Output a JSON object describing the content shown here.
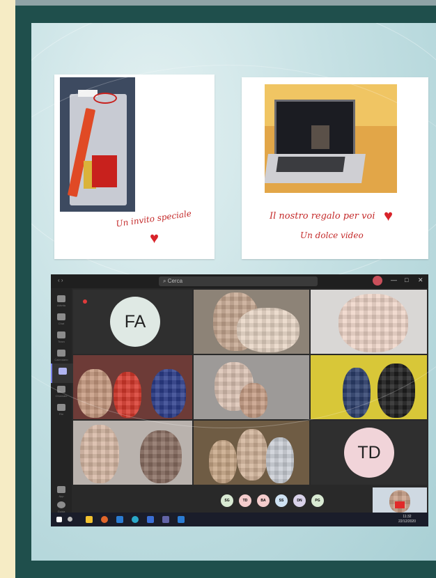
{
  "slide": {
    "left_card": {
      "caption": "Un invito speciale"
    },
    "right_card": {
      "caption_line1": "Il nostro regalo per voi",
      "caption_line2": "Un dolce video"
    }
  },
  "teams": {
    "search_placeholder": "Cerca",
    "window_controls": [
      "—",
      "□",
      "✕"
    ],
    "rail_items": [
      "Attività",
      "Chat",
      "Team",
      "Calendario",
      "Chiamate",
      "File",
      "App",
      "Guida"
    ],
    "tiles": [
      {
        "initials": "FA",
        "circle_color": "#dfe9e4"
      },
      {
        "initials": "TD",
        "circle_color": "#f1d4d9"
      }
    ],
    "participants": [
      {
        "initials": "SG",
        "color": "#d9ead3"
      },
      {
        "initials": "TD",
        "color": "#f4cccc"
      },
      {
        "initials": "BA",
        "color": "#f4cccc"
      },
      {
        "initials": "SS",
        "color": "#cfe2f3"
      },
      {
        "initials": "DN",
        "color": "#d9d2e9"
      },
      {
        "initials": "PG",
        "color": "#d9ead3"
      }
    ],
    "taskbar_time": "11:32",
    "taskbar_date": "22/12/2020"
  },
  "colors": {
    "frame": "#1f4f4c",
    "script_red": "#c42a2a",
    "teams_bg": "#292929"
  }
}
